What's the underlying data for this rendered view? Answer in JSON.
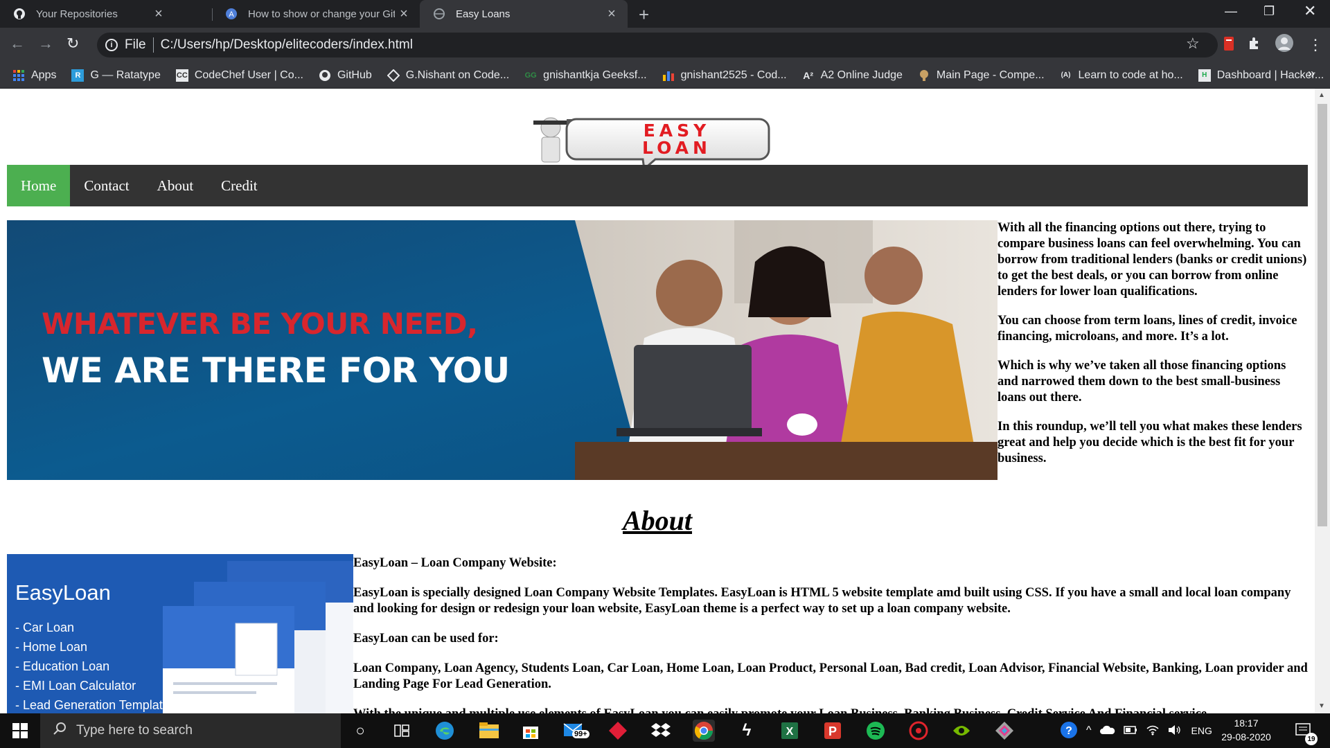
{
  "browser": {
    "tabs": [
      {
        "title": "Your Repositories",
        "icon": "github-icon",
        "active": false
      },
      {
        "title": "How to show or change your Git",
        "icon": "atlassian-icon",
        "active": false
      },
      {
        "title": "Easy Loans",
        "icon": "globe-icon",
        "active": true
      }
    ],
    "address": {
      "scheme_label": "File",
      "url": "C:/Users/hp/Desktop/elitecoders/index.html"
    },
    "bookmarks": [
      {
        "label": "Apps",
        "icon": "apps-grid-icon"
      },
      {
        "label": "G — Ratatype",
        "icon": "ratatype-icon"
      },
      {
        "label": "CodeChef User | Co...",
        "icon": "codechef-icon"
      },
      {
        "label": "GitHub",
        "icon": "github-icon"
      },
      {
        "label": "G.Nishant on Code...",
        "icon": "codeforces-icon"
      },
      {
        "label": "gnishantkja Geeksf...",
        "icon": "geeksforgeeks-icon"
      },
      {
        "label": "gnishant2525 - Cod...",
        "icon": "bars-icon"
      },
      {
        "label": "A2 Online Judge",
        "icon": "a2-icon"
      },
      {
        "label": "Main Page - Compe...",
        "icon": "wiki-icon"
      },
      {
        "label": "Learn to code at ho...",
        "icon": "codecademy-icon"
      },
      {
        "label": "Dashboard | Hacker...",
        "icon": "hackerrank-icon"
      }
    ],
    "bookmarks_more": "»"
  },
  "page": {
    "logo": {
      "line1": "EASY",
      "line2": "LOAN"
    },
    "nav": [
      {
        "label": "Home",
        "active": true
      },
      {
        "label": "Contact",
        "active": false
      },
      {
        "label": "About",
        "active": false
      },
      {
        "label": "Credit",
        "active": false
      }
    ],
    "banner": {
      "line1": "WHATEVER BE YOUR NEED,",
      "line2": "WE ARE THERE FOR YOU"
    },
    "intro_paragraphs": [
      "With all the financing options out there, trying to compare business loans can feel overwhelming. You can borrow from traditional lenders (banks or credit unions) to get the best deals, or you can borrow from online lenders for lower loan qualifications.",
      "You can choose from term loans, lines of credit, invoice financing, microloans, and more. It’s a lot.",
      "Which is why we’ve taken all those financing options and narrowed them down to the best small-business loans out there.",
      "In this roundup, we’ll tell you what makes these lenders great and help you decide which is the best fit for your business."
    ],
    "about_heading": "About",
    "about_image": {
      "brand": "EasyLoan",
      "items": [
        "- Car Loan",
        "- Home Loan",
        "- Education Loan",
        "- EMI Loan Calculator",
        "- Lead Generation Templates"
      ]
    },
    "about_paragraphs": [
      "EasyLoan – Loan Company Website:",
      "EasyLoan is specially designed Loan Company Website Templates. EasyLoan is HTML 5 website template amd built using CSS. If you have a small and local loan company and looking for design or redesign your loan website, EasyLoan theme is a perfect way to set up a loan company website.",
      "EasyLoan can be used for:",
      "Loan Company, Loan Agency, Students Loan, Car Loan, Home Loan, Loan Product, Personal Loan, Bad credit, Loan Advisor, Financial Website, Banking, Loan provider and Landing Page For Lead Generation.",
      "With the unique and multiple use elements of EasyLoan you can easily promote your Loan Business, Banking Business, Credit Service And Financial service"
    ]
  },
  "taskbar": {
    "search_placeholder": "Type here to search",
    "mail_badge": "99+",
    "language": "ENG",
    "time": "18:17",
    "date": "29-08-2020",
    "notification_count": "19"
  },
  "colors": {
    "nav_active": "#4caf50",
    "navbar": "#333333",
    "banner_blue": "#0c5b8f",
    "banner_red": "#d8262d"
  }
}
